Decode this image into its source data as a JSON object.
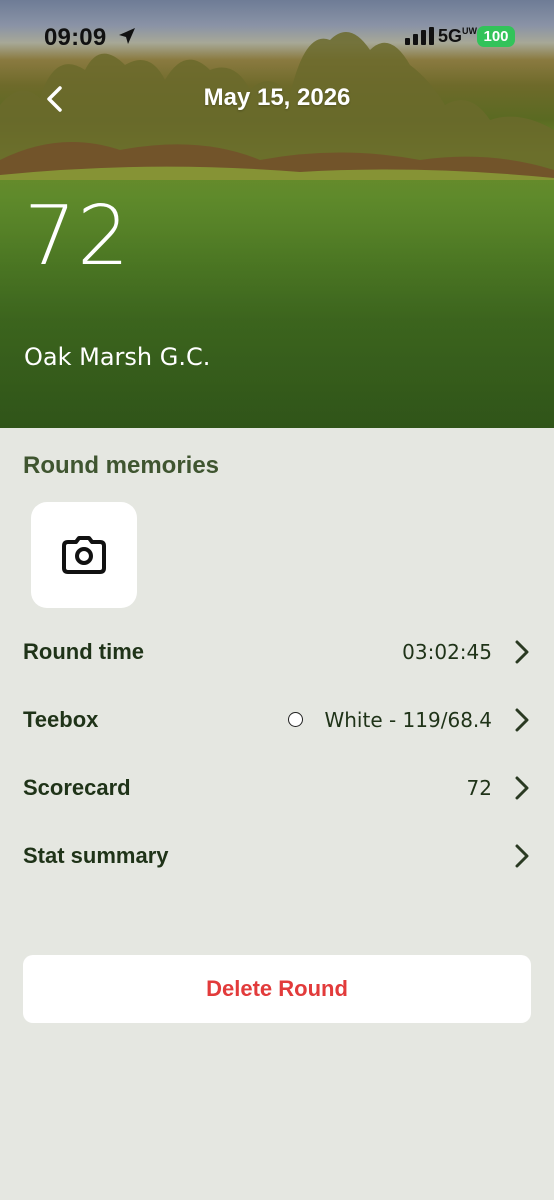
{
  "status_bar": {
    "time": "09:09",
    "network": "5G",
    "network_sup": "UW",
    "battery": "100"
  },
  "nav": {
    "title": "May 15, 2026"
  },
  "hero": {
    "score": "72",
    "course": "Oak Marsh G.C."
  },
  "memories": {
    "title": "Round memories",
    "icon": "camera-icon"
  },
  "rows": [
    {
      "label": "Round time",
      "value": "03:02:45"
    },
    {
      "label": "Teebox",
      "value": "White - 119/68.4"
    },
    {
      "label": "Scorecard",
      "value": "72"
    },
    {
      "label": "Stat summary",
      "value": ""
    }
  ],
  "actions": {
    "delete_label": "Delete Round"
  },
  "colors": {
    "background": "#e5e7e1",
    "heading": "#3f5530",
    "text": "#1f3318",
    "danger": "#e23b3b",
    "battery": "#32c35a"
  }
}
